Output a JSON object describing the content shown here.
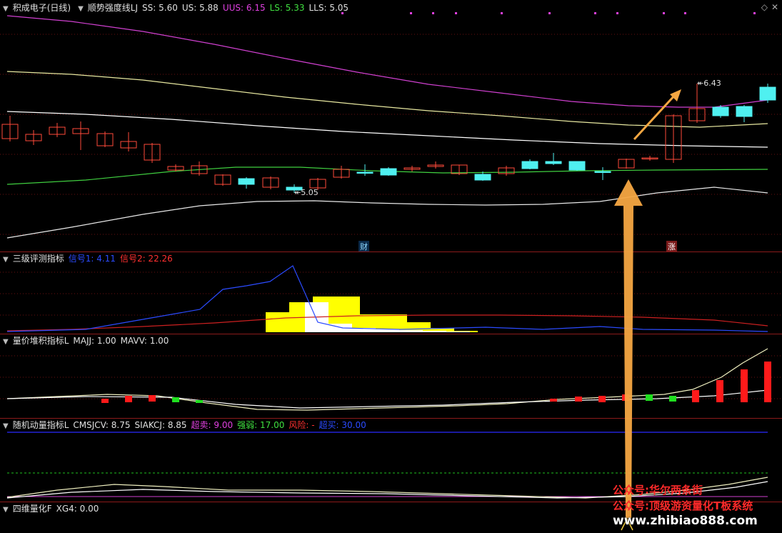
{
  "main_pane": {
    "stock_name": "积成电子",
    "period": "(日线)",
    "indicator": "顺势强度线LJ",
    "values": [
      {
        "label": "SS: 5.60",
        "color": "#e0e0e0"
      },
      {
        "label": "US: 5.88",
        "color": "#e0e0e0"
      },
      {
        "label": "UUS: 6.15",
        "color": "#e040e0"
      },
      {
        "label": "LS: 5.33",
        "color": "#40e040"
      },
      {
        "label": "LLS: 5.05",
        "color": "#e0e0e0"
      }
    ],
    "high_label": "6.43",
    "low_label": "5.05",
    "marker_cai": "财",
    "marker_zhang": "涨"
  },
  "pane2": {
    "title": "三级评测指标",
    "values": [
      {
        "label": "信号1: 4.11",
        "color": "#2b4bff"
      },
      {
        "label": "信号2: 22.26",
        "color": "#ff3030"
      }
    ]
  },
  "pane3": {
    "title": "量价堆积指标L",
    "values": [
      {
        "label": "MAJJ: 1.00",
        "color": "#e0e0e0"
      },
      {
        "label": "MAVV: 1.00",
        "color": "#e0e0e0"
      }
    ]
  },
  "pane4": {
    "title": "随机动量指标L",
    "values": [
      {
        "label": "CMSJCV: 8.75",
        "color": "#e0e0e0"
      },
      {
        "label": "SIAKCJ: 8.85",
        "color": "#e0e0e0"
      },
      {
        "label": "超卖: 9.00",
        "color": "#e040e0"
      },
      {
        "label": "强弱: 17.00",
        "color": "#40e040"
      },
      {
        "label": "风险: -",
        "color": "#ff3030"
      },
      {
        "label": "超买: 30.00",
        "color": "#2b4bff"
      }
    ]
  },
  "pane5": {
    "title": "四维量化F",
    "values": [
      {
        "label": "XG4: 0.00",
        "color": "#e0e0e0"
      }
    ]
  },
  "watermark": {
    "line1": "公众号:华尔两条街",
    "line2": "公众号:顶级游资量化T板系统",
    "line3": "www.zhibiao888.com"
  },
  "colors": {
    "up_candle": "#ff4a3a",
    "down_candle": "#4ff0f0",
    "uus_line": "#d040d0",
    "us_line": "#e8e8a0",
    "ss_line": "#ffffff",
    "ls_line": "#40d040",
    "lls_line": "#e8e8e8",
    "arrow": "#f5a742",
    "separator": "#8b1a1a"
  },
  "icons": [
    "collapse-triangle-icon",
    "diamond-icon",
    "close-x-icon"
  ]
}
